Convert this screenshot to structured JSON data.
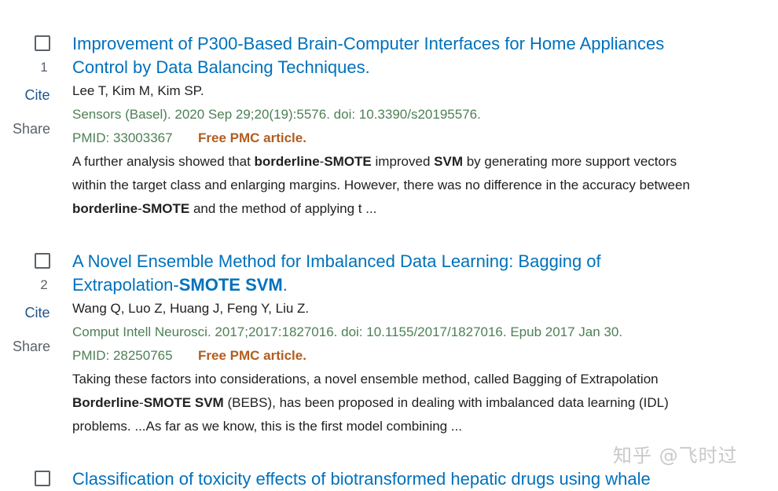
{
  "results": [
    {
      "number": "1",
      "cite_label": "Cite",
      "share_label": "Share",
      "title_line1": "Improvement of P300-Based Brain-Computer Interfaces for Home Appliances",
      "title_line2": "Control by Data Balancing Techniques.",
      "authors": "Lee T, Kim M, Kim SP.",
      "journal": "Sensors (Basel). 2020 Sep 29;20(19):5576. doi: 10.3390/s20195576.",
      "pmid": "PMID: 33003367",
      "pmc": "Free PMC article.",
      "snippet": {
        "l1a": "A further analysis showed that ",
        "l1b": "borderline",
        "l1c": "-",
        "l1d": "SMOTE",
        "l1e": " improved ",
        "l1f": "SVM",
        "l1g": " by generating more support vectors",
        "l2": "within the target class and enlarging margins. However, there was no difference in the accuracy between",
        "l3a": "borderline",
        "l3b": "-",
        "l3c": "SMOTE",
        "l3d": " and the method of applying t ..."
      }
    },
    {
      "number": "2",
      "cite_label": "Cite",
      "share_label": "Share",
      "title_line1": "A Novel Ensemble Method for Imbalanced Data Learning: Bagging of",
      "title_line2a": "Extrapolation-",
      "title_line2b": "SMOTE SVM",
      "title_line2c": ".",
      "authors": "Wang Q, Luo Z, Huang J, Feng Y, Liu Z.",
      "journal": "Comput Intell Neurosci. 2017;2017:1827016. doi: 10.1155/2017/1827016. Epub 2017 Jan 30.",
      "pmid": "PMID: 28250765",
      "pmc": "Free PMC article.",
      "snippet": {
        "l1": "Taking these factors into considerations, a novel ensemble method, called Bagging of Extrapolation",
        "l2a": "Borderline",
        "l2b": "-",
        "l2c": "SMOTE SVM",
        "l2d": " (BEBS), has been proposed in dealing with imbalanced data learning (IDL)",
        "l3": "problems. ...As far as we know, this is the first model combining ..."
      }
    },
    {
      "title_line1": "Classification of toxicity effects of biotransformed hepatic drugs using whale"
    }
  ],
  "watermark": "知乎 @飞时过"
}
